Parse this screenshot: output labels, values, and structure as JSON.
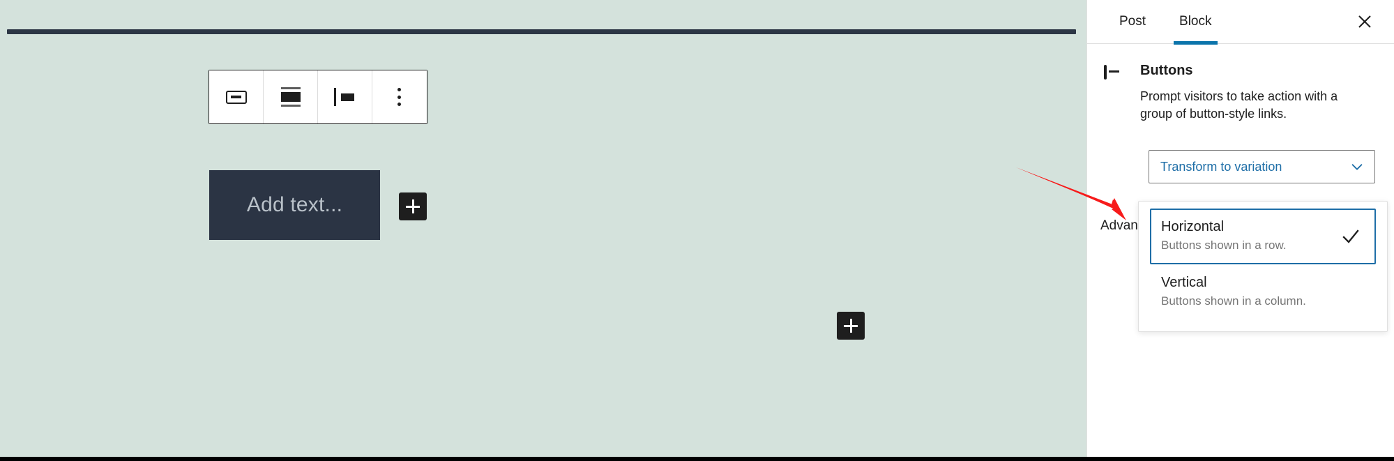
{
  "canvas": {
    "background_color": "#d4e2dc",
    "toolbar": {
      "buttons": [
        {
          "name": "buttons-block-icon",
          "label": "Buttons"
        },
        {
          "name": "align-center-icon",
          "label": "Change alignment"
        },
        {
          "name": "align-left-icon",
          "label": "Change items justification"
        },
        {
          "name": "more-options-icon",
          "label": "Options"
        }
      ]
    },
    "button_block": {
      "placeholder": "Add text...",
      "background_color": "#2b3444",
      "text_color": "#b9c1c9"
    },
    "appenders": [
      {
        "name": "inline-appender",
        "label": "+"
      },
      {
        "name": "block-appender",
        "label": "+"
      }
    ]
  },
  "sidebar": {
    "tabs": [
      {
        "label": "Post",
        "active": false
      },
      {
        "label": "Block",
        "active": true
      }
    ],
    "active_tab_color": "#0b74ab",
    "close_label": "Close settings",
    "block_card": {
      "title": "Buttons",
      "description": "Prompt visitors to take action with a group of button-style links.",
      "icon": "buttons-block-icon"
    },
    "transform_select": {
      "label": "Transform to variation",
      "text_color": "#1e6ea7",
      "chevron": "chevron-down-icon"
    },
    "advanced_panel": {
      "label": "Advanced"
    },
    "variation_popover": {
      "items": [
        {
          "title": "Horizontal",
          "description": "Buttons shown in a row.",
          "selected": true
        },
        {
          "title": "Vertical",
          "description": "Buttons shown in a column.",
          "selected": false
        }
      ]
    }
  },
  "annotation": {
    "arrow_color": "#f71b1b",
    "name": "red-pointer-arrow"
  }
}
